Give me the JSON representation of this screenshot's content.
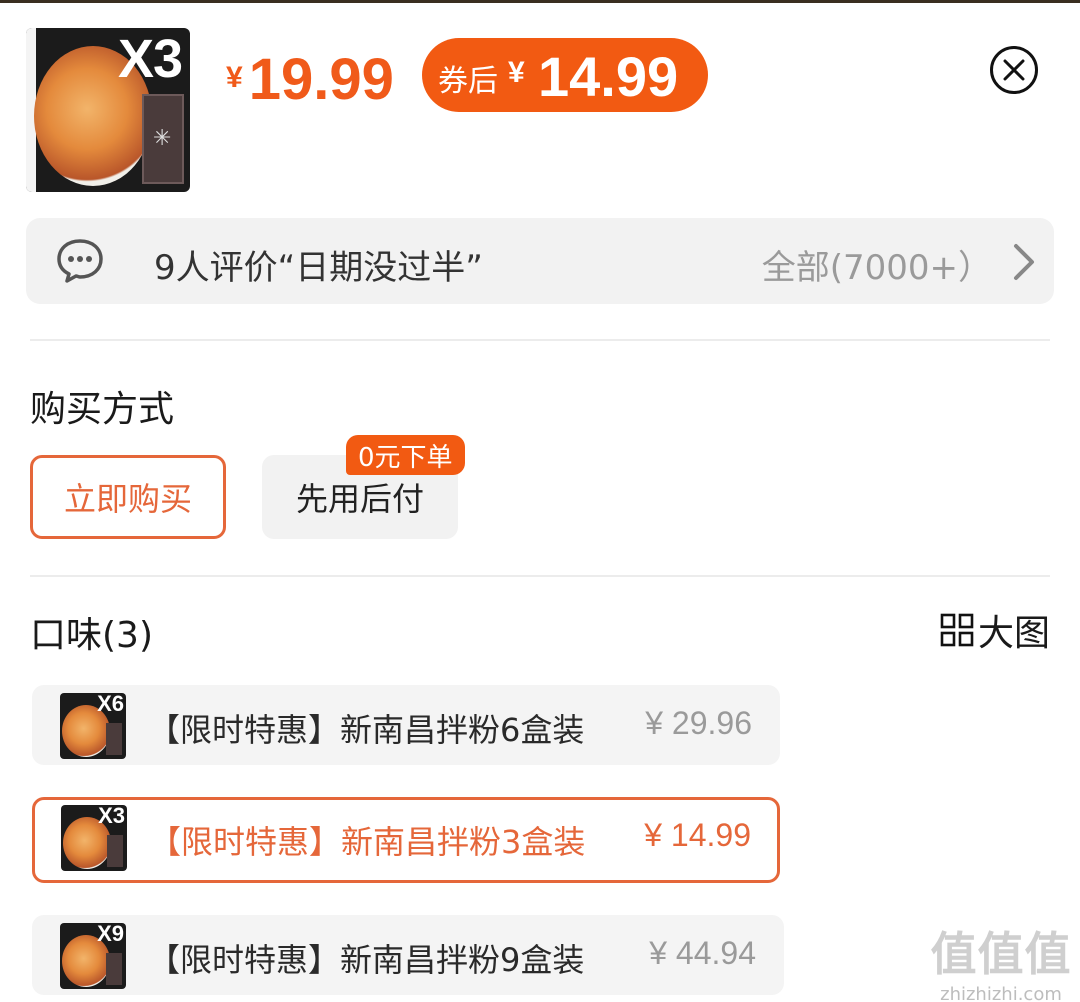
{
  "product": {
    "thumb_multiplier": "X3",
    "price_symbol": "¥",
    "price": "19.99",
    "coupon_label": "券后",
    "coupon_symbol": "¥",
    "coupon_price": "14.99"
  },
  "reviews": {
    "summary": "9人评价“日期没过半”",
    "all_label": "全部(7000+）"
  },
  "purchase": {
    "title": "购买方式",
    "options": [
      {
        "label": "立即购买",
        "selected": true
      },
      {
        "label": "先用后付",
        "selected": false,
        "badge": "0元下单"
      }
    ]
  },
  "flavor": {
    "title": "口味(3)",
    "big_picture_label": "大图",
    "items": [
      {
        "multiplier": "X6",
        "name": "【限时特惠】新南昌拌粉6盒装",
        "price": "¥ 29.96",
        "selected": false
      },
      {
        "multiplier": "X3",
        "name": "【限时特惠】新南昌拌粉3盒装",
        "price": "¥ 14.99",
        "selected": true
      },
      {
        "multiplier": "X9",
        "name": "【限时特惠】新南昌拌粉9盒装",
        "price": "¥ 44.94",
        "selected": false
      }
    ]
  },
  "watermark": {
    "logo": "值值值",
    "url": "zhizhizhi.com"
  },
  "colors": {
    "accent": "#f25a12",
    "selected_border": "#e5673a",
    "muted": "#9a9a9a",
    "panel": "#f2f2f2"
  },
  "icons": [
    "chat-bubble-icon",
    "chevron-right-icon",
    "close-icon",
    "grid-icon"
  ]
}
